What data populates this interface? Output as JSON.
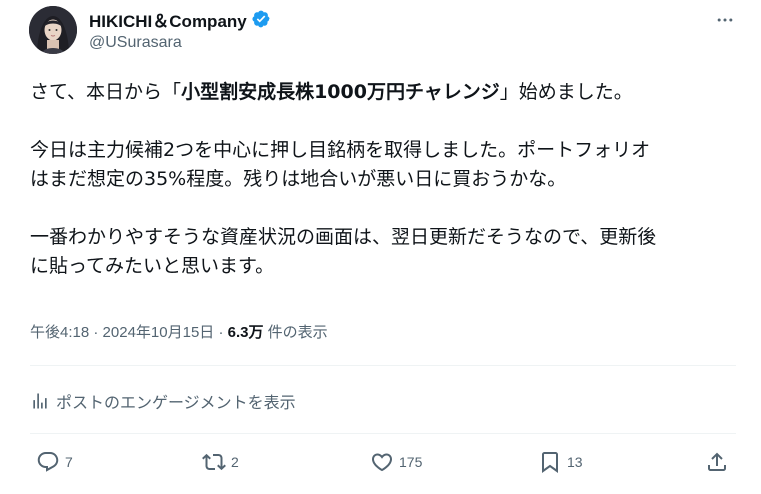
{
  "author": {
    "display_name": "HIKICHI＆Company",
    "handle": "@USurasara",
    "verified": true
  },
  "tweet": {
    "line1_pre": "さて、本日から「",
    "line1_bold": "小型割安成長株1000万円チャレンジ",
    "line1_post": "」始めました。",
    "para2_line1": "今日は主力候補2つを中心に押し目銘柄を取得しました。ポートフォリオ",
    "para2_line2": "はまだ想定の35%程度。残りは地合いが悪い日に買おうかな。",
    "para3_line1": "一番わかりやすそうな資産状況の画面は、翌日更新だそうなので、更新後",
    "para3_line2": "に貼ってみたいと思います。"
  },
  "meta": {
    "time": "午後4:18",
    "separator1": " · ",
    "date": "2024年10月15日",
    "separator2": " · ",
    "views": "6.3万",
    "views_suffix": " 件の表示"
  },
  "engagements_link": "ポストのエンゲージメントを表示",
  "actions": {
    "reply_count": "7",
    "repost_count": "2",
    "like_count": "175",
    "bookmark_count": "13"
  },
  "colors": {
    "text": "#0f1419",
    "secondary": "#536471",
    "verified": "#1d9bf0",
    "divider": "#eff3f4"
  },
  "icons": [
    "verified-badge-icon",
    "more-icon",
    "analytics-icon",
    "reply-icon",
    "repost-icon",
    "like-icon",
    "bookmark-icon",
    "share-icon"
  ]
}
